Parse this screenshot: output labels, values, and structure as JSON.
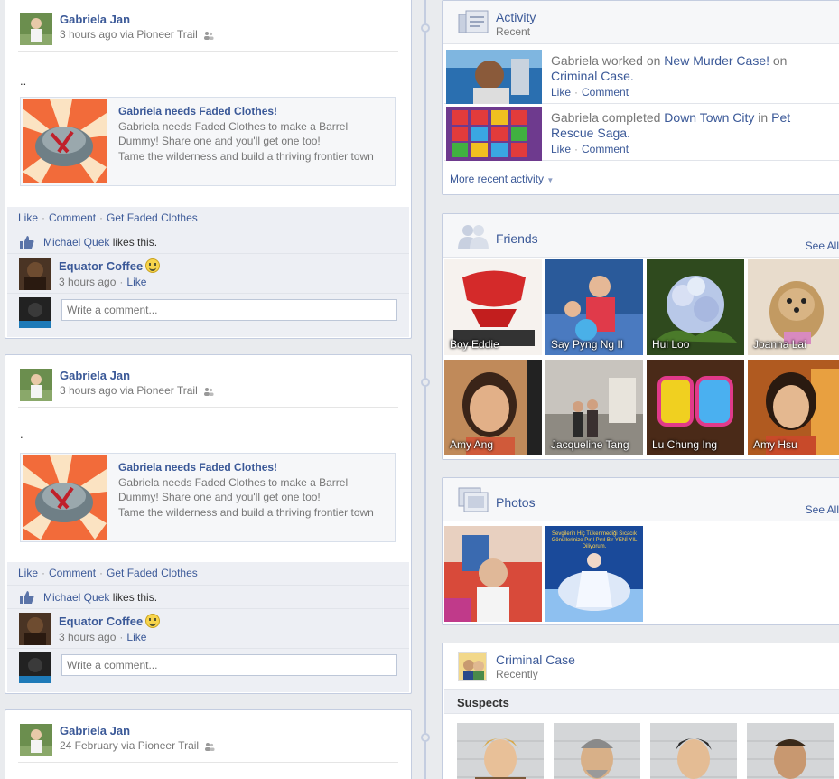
{
  "posts": [
    {
      "author": "Gabriela Jan",
      "meta": "3 hours ago via Pioneer Trail",
      "text": "..",
      "attachment": {
        "title": "Gabriela needs Faded Clothes!",
        "description": "Gabriela needs Faded Clothes to make a Barrel Dummy! Share one and you'll get one too!",
        "caption": "Tame the wilderness and build a thriving frontier town"
      },
      "actions": {
        "like": "Like",
        "comment": "Comment",
        "extra": "Get Faded Clothes"
      },
      "likes": {
        "name": "Michael Quek",
        "suffix": " likes this."
      },
      "comment": {
        "author": "Equator Coffee",
        "time": "3 hours ago",
        "like": "Like"
      },
      "input_placeholder": "Write a comment..."
    },
    {
      "author": "Gabriela Jan",
      "meta": "3 hours ago via Pioneer Trail",
      "text": ".",
      "attachment": {
        "title": "Gabriela needs Faded Clothes!",
        "description": "Gabriela needs Faded Clothes to make a Barrel Dummy! Share one and you'll get one too!",
        "caption": "Tame the wilderness and build a thriving frontier town"
      },
      "actions": {
        "like": "Like",
        "comment": "Comment",
        "extra": "Get Faded Clothes"
      },
      "likes": {
        "name": "Michael Quek",
        "suffix": " likes this."
      },
      "comment": {
        "author": "Equator Coffee",
        "time": "3 hours ago",
        "like": "Like"
      },
      "input_placeholder": "Write a comment..."
    },
    {
      "author": "Gabriela Jan",
      "meta": "24 February via Pioneer Trail"
    }
  ],
  "activity": {
    "title": "Activity",
    "subtitle": "Recent",
    "items": [
      {
        "prefix": "Gabriela worked on ",
        "link": "New Murder Case!",
        "middle": " on ",
        "app": "Criminal Case.",
        "like": "Like",
        "comment": "Comment"
      },
      {
        "prefix": "Gabriela completed ",
        "link": "Down Town City",
        "middle": " in ",
        "app": "Pet Rescue Saga.",
        "like": "Like",
        "comment": "Comment"
      }
    ],
    "more": "More recent activity"
  },
  "friends": {
    "title": "Friends",
    "see_all": "See All",
    "list": [
      "Boy Eddie",
      "Say Pyng Ng II",
      "Hui Loo",
      "Joanna Lai",
      "Amy Ang",
      "Jacqueline Tang",
      "Lu Chung Ing",
      "Amy Hsu"
    ]
  },
  "photos": {
    "title": "Photos",
    "see_all": "See All",
    "photo2_text": "Sevgilerin Hiç Tükenmediği Sıcacık Gönüllerinize Pırıl Pırıl Bir YENİ YIL Diliyorum."
  },
  "criminal_case": {
    "title": "Criminal Case",
    "subtitle": "Recently",
    "section": "Suspects"
  },
  "colors": {
    "link": "#3b5998",
    "background": "#e9ebee",
    "border": "#c4cde0"
  }
}
